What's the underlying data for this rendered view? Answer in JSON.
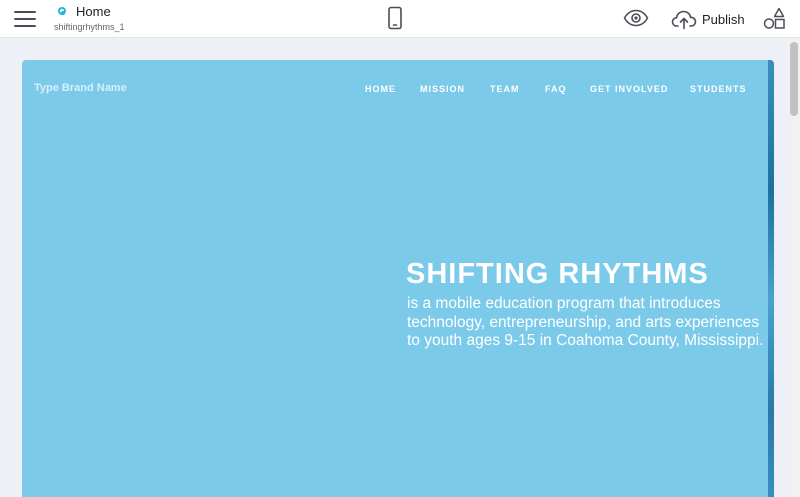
{
  "toolbar": {
    "page_title": "Home",
    "page_subtitle": "shiftingrhythms_1",
    "publish_label": "Publish",
    "icons": [
      "hamburger-menu-icon",
      "page-icon",
      "mobile-view-icon",
      "eye-icon",
      "cloud-upload-icon",
      "shapes-icon"
    ]
  },
  "site": {
    "brand_name": "Type Brand Name",
    "nav": [
      "HOME",
      "MISSION",
      "TEAM",
      "FAQ",
      "GET INVOLVED",
      "STUDENTS"
    ],
    "hero_title": "SHIFTING RHYTHMS",
    "hero_text": "is a mobile education program that introduces technology, entrepreneurship, and arts experiences to youth ages 9-15 in Coahoma County, Mississippi."
  },
  "colors": {
    "accent": "#1fb6d6",
    "canvas_bg": "#7ccaea",
    "toolbar_bg": "#ffffff",
    "workspace_bg": "#eef0f7"
  }
}
